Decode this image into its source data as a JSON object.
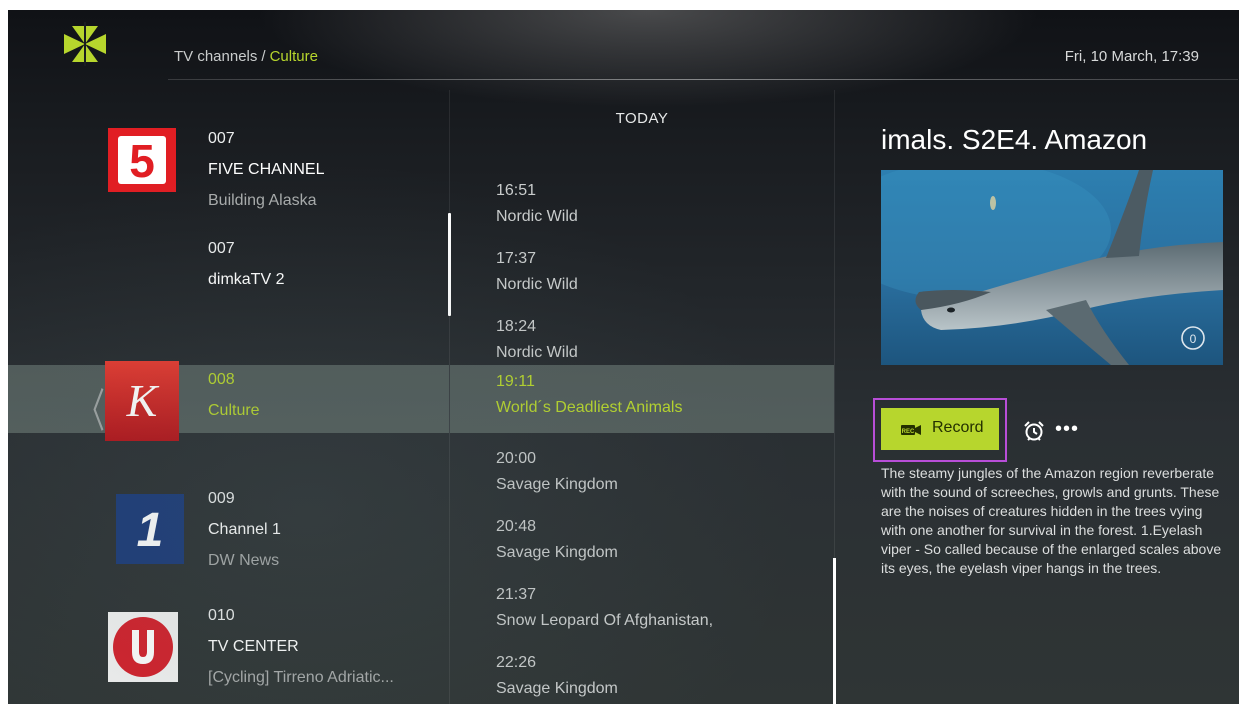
{
  "header": {
    "breadcrumb_root": "TV channels",
    "breadcrumb_separator": "/",
    "breadcrumb_current": "Culture",
    "datetime": "Fri, 10 March, 17:39"
  },
  "channels": [
    {
      "number": "007",
      "name": "FIVE CHANNEL",
      "current_show": "Building Alaska",
      "logo": "five-channel-logo",
      "logo_text": "5"
    },
    {
      "number": "007",
      "name": "dimkaTV 2",
      "current_show": "",
      "logo": ""
    },
    {
      "number": "008",
      "name": "Culture",
      "current_show": "",
      "logo": "culture-logo",
      "logo_text": "K",
      "selected": true
    },
    {
      "number": "009",
      "name": "Channel 1",
      "current_show": "DW News",
      "logo": "channel-1-logo",
      "logo_text": "1"
    },
    {
      "number": "010",
      "name": "TV CENTER",
      "current_show": "[Cycling] Tirreno Adriatic...",
      "logo": "tv-center-logo"
    }
  ],
  "schedule": {
    "day_label": "TODAY",
    "items": [
      {
        "time": "16:51",
        "title": "Nordic Wild"
      },
      {
        "time": "17:37",
        "title": "Nordic Wild"
      },
      {
        "time": "18:24",
        "title": "Nordic Wild"
      },
      {
        "time": "19:11",
        "title": "World´s Deadliest Animals",
        "selected": true
      },
      {
        "time": "20:00",
        "title": "Savage Kingdom"
      },
      {
        "time": "20:48",
        "title": "Savage Kingdom"
      },
      {
        "time": "21:37",
        "title": "Snow Leopard Of Afghanistan,"
      },
      {
        "time": "22:26",
        "title": "Savage Kingdom"
      }
    ]
  },
  "details": {
    "title": "imals. S2E4. Amazon",
    "record_label": "Record",
    "record_icon": "rec-camera-icon",
    "alarm_icon": "alarm-clock-icon",
    "more_icon": "more-options-icon",
    "description": "The steamy jungles of the Amazon region reverberate with the sound of screeches, growls and grunts. These are the noises of creatures hidden in the trees vying with one another for survival in the forest. 1.Eyelash viper - So called because of the enlarged scales above its eyes, the eyelash viper hangs in the trees."
  },
  "colors": {
    "accent": "#b7d62d",
    "highlight_border": "#b84ed8",
    "selected_row": "#56605c"
  }
}
